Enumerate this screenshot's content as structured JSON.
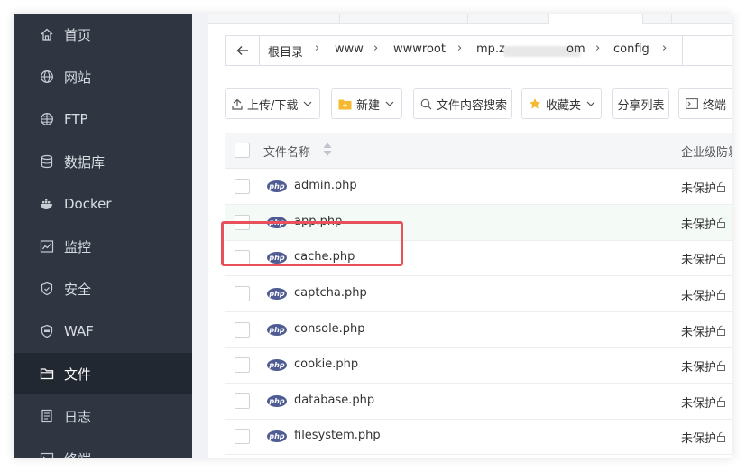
{
  "sidebar": {
    "items": [
      {
        "label": "首页",
        "icon": "home-icon"
      },
      {
        "label": "网站",
        "icon": "globe-icon"
      },
      {
        "label": "FTP",
        "icon": "ftp-globe-icon"
      },
      {
        "label": "数据库",
        "icon": "database-icon"
      },
      {
        "label": "Docker",
        "icon": "docker-icon"
      },
      {
        "label": "监控",
        "icon": "monitor-chart-icon"
      },
      {
        "label": "安全",
        "icon": "shield-icon"
      },
      {
        "label": "WAF",
        "icon": "waf-shield-icon"
      },
      {
        "label": "文件",
        "icon": "folder-icon",
        "active": true
      },
      {
        "label": "日志",
        "icon": "log-icon"
      },
      {
        "label": "终端",
        "icon": "terminal-icon"
      }
    ]
  },
  "breadcrumb": {
    "items": [
      "根目录",
      "www",
      "wwwroot",
      "mp.z",
      "om",
      "config"
    ]
  },
  "toolbar": {
    "upload_label": "上传/下载",
    "new_label": "新建",
    "search_content_label": "文件内容搜索",
    "favorites_label": "收藏夹",
    "share_list_label": "分享列表",
    "terminal_label": "终端"
  },
  "table": {
    "col_name": "文件名称",
    "col_protect": "企业级防篡",
    "badge_text": "php",
    "rows": [
      {
        "name": "admin.php",
        "status": "未保护"
      },
      {
        "name": "app.php",
        "status": "未保护"
      },
      {
        "name": "cache.php",
        "status": "未保护"
      },
      {
        "name": "captcha.php",
        "status": "未保护"
      },
      {
        "name": "console.php",
        "status": "未保护"
      },
      {
        "name": "cookie.php",
        "status": "未保护"
      },
      {
        "name": "database.php",
        "status": "未保护"
      },
      {
        "name": "filesystem.php",
        "status": "未保护"
      }
    ]
  },
  "colors": {
    "sidebar_bg": "#2f3642",
    "sidebar_active_bg": "#222831",
    "highlight": "#e8505b",
    "php_badge": "#4f5b93",
    "folder_yellow": "#f5b82e"
  }
}
